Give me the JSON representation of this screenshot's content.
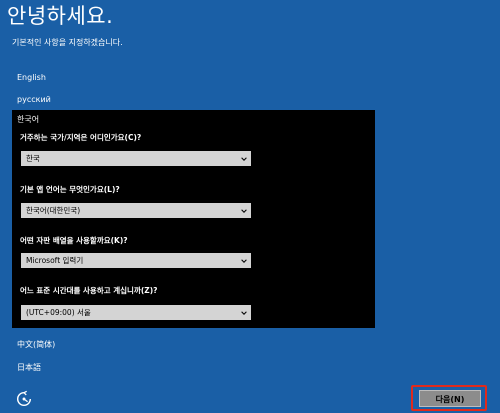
{
  "header": {
    "title": "안녕하세요.",
    "subtitle": "기본적인 사항을 지정하겠습니다."
  },
  "languages": {
    "english": "English",
    "russian": "русский",
    "korean_selected": "한국어",
    "chinese": "中文(简体)",
    "japanese": "日本語"
  },
  "questions": [
    {
      "label": "거주하는 국가/지역은 어디인가요(C)?",
      "value": "한국"
    },
    {
      "label": "기본 앱 언어는 무엇인가요(L)?",
      "value": "한국어(대한민국)"
    },
    {
      "label": "어떤 자판 배열을 사용할까요(K)?",
      "value": "Microsoft 입력기"
    },
    {
      "label": "어느 표준 시간대를 사용하고 계십니까(Z)?",
      "value": "(UTC+09:00) 서울"
    }
  ],
  "footer": {
    "next_label": "다음(N)",
    "power_icon": "power-icon"
  },
  "colors": {
    "background": "#1a5fa6",
    "panel": "#000000",
    "select": "#d4d4d4",
    "highlight": "#e02a1c"
  }
}
